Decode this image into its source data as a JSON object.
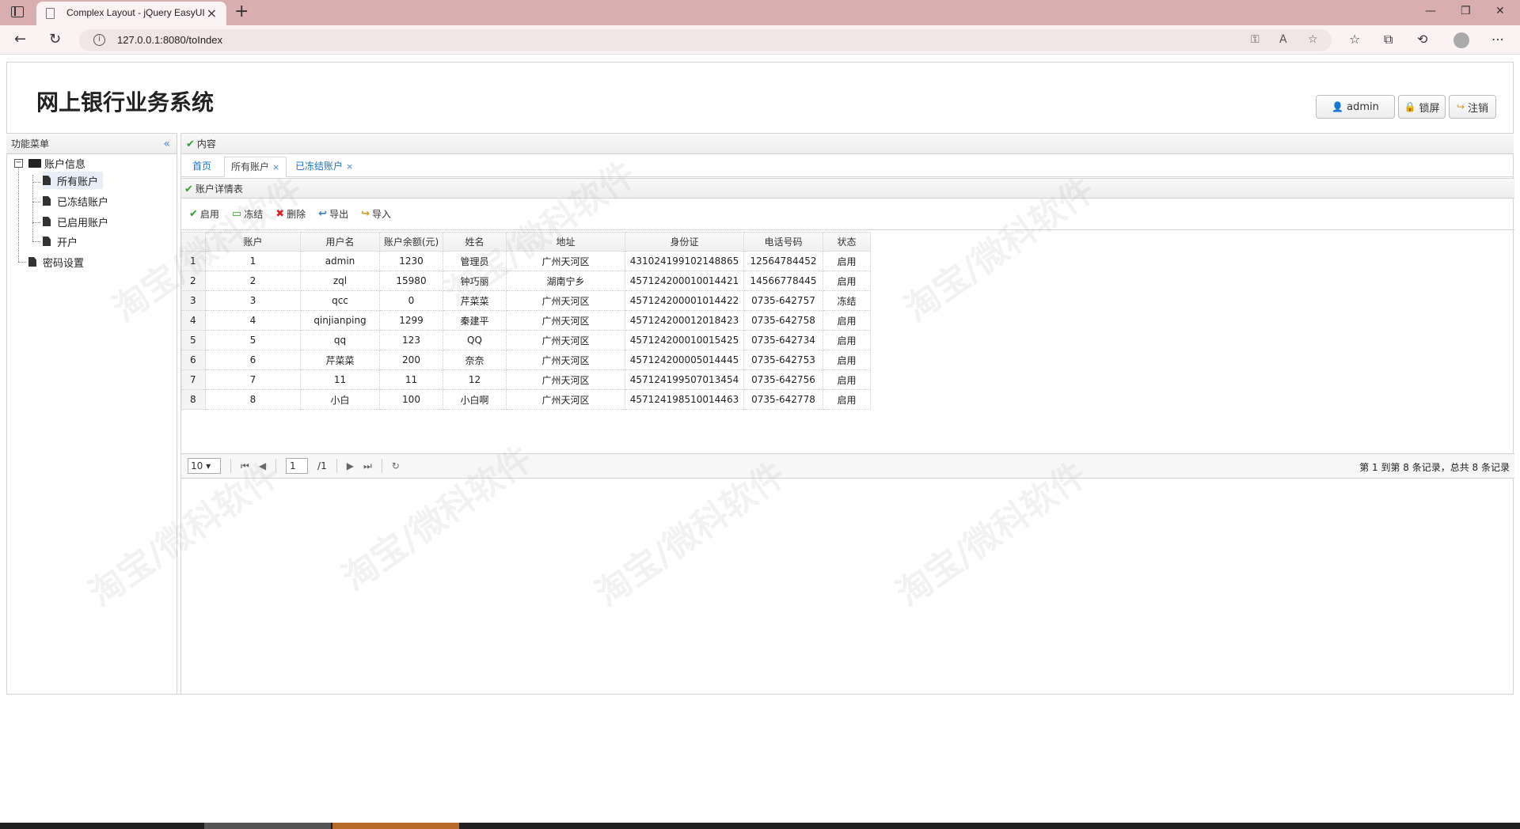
{
  "browser": {
    "tab_title": "Complex Layout - jQuery EasyUI",
    "url": "127.0.0.1:8080/toIndex",
    "new_tab": "+",
    "close_tab": "×"
  },
  "header": {
    "brand": "网上银行业务系统",
    "user_label": "admin",
    "lock_label": "锁屏",
    "logout_label": "注销"
  },
  "menu": {
    "title": "功能菜单",
    "collapse": "«",
    "root": "账户信息",
    "items": [
      "所有账户",
      "已冻结账户",
      "已启用账户",
      "开户"
    ],
    "password": "密码设置"
  },
  "content": {
    "title": "内容",
    "tabs": [
      {
        "label": "首页"
      },
      {
        "label": "所有账户"
      },
      {
        "label": "已冻结账户"
      }
    ],
    "tab_close": "×"
  },
  "grid": {
    "title": "账户详情表",
    "toolbar": {
      "enable": "启用",
      "freeze": "冻结",
      "delete": "删除",
      "export": "导出",
      "import": "导入"
    },
    "columns": [
      "",
      "账户",
      "用户名",
      "账户余额(元)",
      "姓名",
      "地址",
      "身份证",
      "电话号码",
      "状态"
    ],
    "rows": [
      [
        "1",
        "1",
        "admin",
        "1230",
        "管理员",
        "广州天河区",
        "431024199102148865",
        "12564784452",
        "启用"
      ],
      [
        "2",
        "2",
        "zql",
        "15980",
        "钟巧丽",
        "湖南宁乡",
        "457124200010014421",
        "14566778445",
        "启用"
      ],
      [
        "3",
        "3",
        "qcc",
        "0",
        "芹菜菜",
        "广州天河区",
        "457124200001014422",
        "0735-642757",
        "冻结"
      ],
      [
        "4",
        "4",
        "qinjianping",
        "1299",
        "秦建平",
        "广州天河区",
        "457124200012018423",
        "0735-642758",
        "启用"
      ],
      [
        "5",
        "5",
        "qq",
        "123",
        "QQ",
        "广州天河区",
        "457124200010015425",
        "0735-642734",
        "启用"
      ],
      [
        "6",
        "6",
        "芹菜菜",
        "200",
        "奈奈",
        "广州天河区",
        "457124200005014445",
        "0735-642753",
        "启用"
      ],
      [
        "7",
        "7",
        "11",
        "11",
        "12",
        "广州天河区",
        "457124199507013454",
        "0735-642756",
        "启用"
      ],
      [
        "8",
        "8",
        "小白",
        "100",
        "小白啊",
        "广州天河区",
        "457124198510014463",
        "0735-642778",
        "启用"
      ]
    ]
  },
  "pager": {
    "page_size": "10",
    "page": "1",
    "total_pages": "/1",
    "info": "第 1 到第 8 条记录，总共 8 条记录"
  },
  "watermark": "淘宝/微科软件"
}
